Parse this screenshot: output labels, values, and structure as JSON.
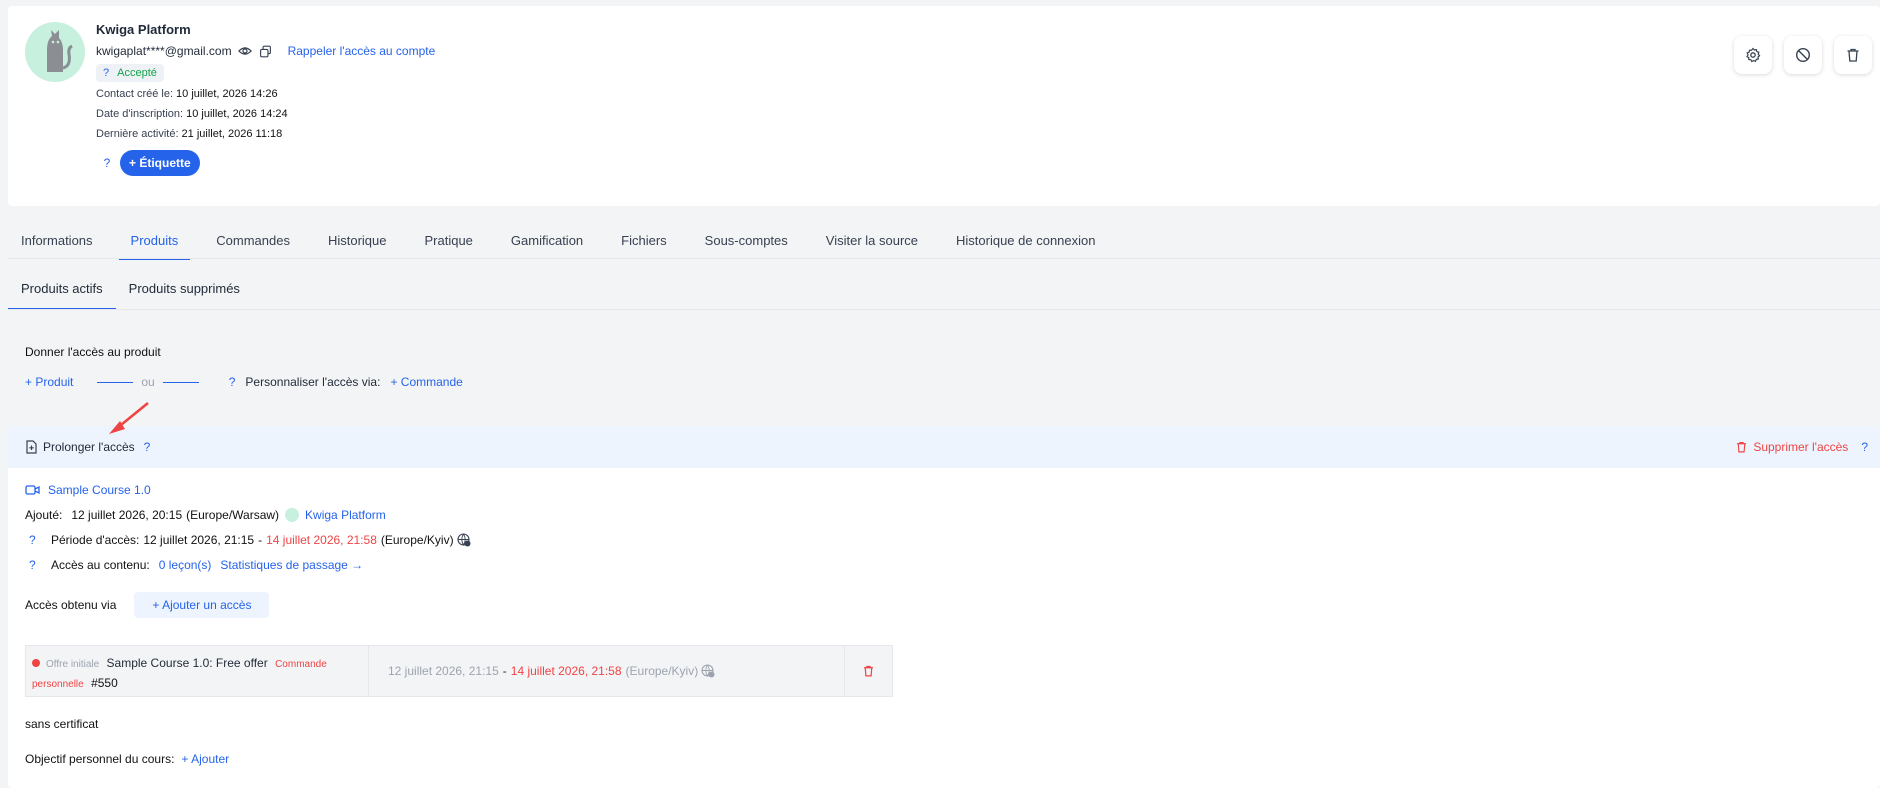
{
  "profile": {
    "name": "Kwiga Platform",
    "email": "kwigaplat****@gmail.com",
    "recall_link": "Rappeler l'accès au compte",
    "status_q": "?",
    "status": "Accepté",
    "created_label": "Contact créé le:",
    "created_value": "10 juillet, 2026 14:26",
    "registered_label": "Date d'inscription:",
    "registered_value": "10 juillet, 2026 14:24",
    "activity_label": "Dernière activité:",
    "activity_value": "21 juillet, 2026 11:18",
    "tag_q": "?",
    "tag_button": "+ Étiquette"
  },
  "tabs": [
    "Informations",
    "Produits",
    "Commandes",
    "Historique",
    "Pratique",
    "Gamification",
    "Fichiers",
    "Sous-comptes",
    "Visiter la source",
    "Historique de connexion"
  ],
  "subtabs": [
    "Produits actifs",
    "Produits supprimés"
  ],
  "give_access": {
    "title": "Donner l'accès au produit",
    "product_link": "+ Produit",
    "or": "ou",
    "q": "?",
    "customize_label": "Personnaliser l'accès via:",
    "order_link": "+ Commande"
  },
  "product": {
    "extend_label": "Prolonger l'accès",
    "extend_q": "?",
    "delete_label": "Supprimer l'accès",
    "delete_q": "?",
    "course_name": "Sample Course 1.0",
    "added_label": "Ajouté:",
    "added_value": "12 juillet 2026, 20:15",
    "added_tz": "(Europe/Warsaw)",
    "added_by": "Kwiga Platform",
    "period_q": "?",
    "period_label": "Période d'accès:",
    "period_start": "12 juillet 2026, 21:15",
    "period_sep": "-",
    "period_end": "14 juillet 2026, 21:58",
    "period_tz": "(Europe/Kyiv)",
    "content_q": "?",
    "content_label": "Accès au contenu:",
    "lessons": "0 leçon(s)",
    "stats_link": "Statistiques de passage →",
    "obtained_label": "Accès obtenu via",
    "add_access_button": "+ Ajouter un accès",
    "offer": {
      "badge": "Offre initiale",
      "name": "Sample Course 1.0: Free offer",
      "order_type_1": "Commande",
      "order_type_2": "personnelle",
      "order_number": "#550",
      "start": "12 juillet 2026, 21:15",
      "sep": "-",
      "end": "14 juillet 2026, 21:58",
      "tz": "(Europe/Kyiv)"
    },
    "certificate": "sans certificat",
    "goal_label": "Objectif personnel du cours:",
    "goal_link": "+ Ajouter"
  },
  "colors": {
    "accent": "#2563eb",
    "danger": "#ef4444",
    "success": "#16a34a"
  }
}
